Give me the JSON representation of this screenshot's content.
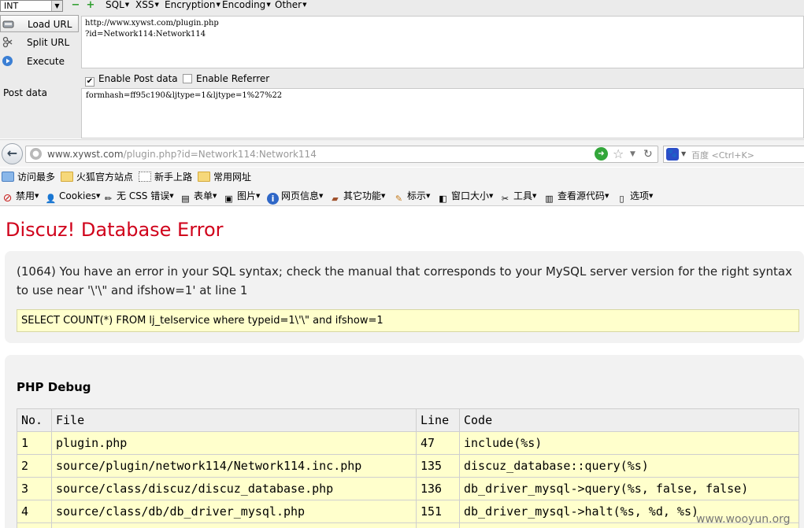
{
  "hackbar": {
    "int_select": "INT",
    "menus": [
      "SQL",
      "XSS",
      "Encryption",
      "Encoding",
      "Other"
    ],
    "actions": {
      "load_url": "Load URL",
      "split_url": "Split URL",
      "execute": "Execute"
    },
    "url_value": "http://www.xywst.com/plugin.php\n?id=Network114:Network114",
    "enable_post_label": "Enable Post data",
    "enable_post_checked": true,
    "enable_referrer_label": "Enable Referrer",
    "enable_referrer_checked": false,
    "post_label": "Post data",
    "post_value": "formhash=ff95c190&ljtype=1&ljtype=1%27%22"
  },
  "navbar": {
    "url_host": "www.xywst.com",
    "url_rest": "/plugin.php?id=Network114:Network114",
    "search_placeholder": "百度 <Ctrl+K>"
  },
  "bookmarks": [
    {
      "label": "访问最多",
      "icon": "most-visited-icon"
    },
    {
      "label": "火狐官方站点",
      "icon": "folder-icon"
    },
    {
      "label": "新手上路",
      "icon": "page-icon"
    },
    {
      "label": "常用网址",
      "icon": "folder-icon"
    }
  ],
  "devbar": [
    "禁用",
    "Cookies",
    "无 CSS 错误",
    "表单",
    "图片",
    "网页信息",
    "其它功能",
    "标示",
    "窗口大小",
    "工具",
    "查看源代码",
    "选项"
  ],
  "page": {
    "error_title": "Discuz! Database Error",
    "error_message": "(1064) You have an error in your SQL syntax; check the manual that corresponds to your MySQL server version for the right syntax to use near '\\'\\\" and ifshow=1' at line 1",
    "error_sql": "SELECT COUNT(*) FROM lj_telservice where typeid=1\\'\\\" and ifshow=1",
    "debug_title": "PHP Debug",
    "debug_headers": [
      "No.",
      "File",
      "Line",
      "Code"
    ],
    "debug_rows": [
      [
        "1",
        "plugin.php",
        "47",
        "include(%s)"
      ],
      [
        "2",
        "source/plugin/network114/Network114.inc.php",
        "135",
        "discuz_database::query(%s)"
      ],
      [
        "3",
        "source/class/discuz/discuz_database.php",
        "136",
        "db_driver_mysql->query(%s, false, false)"
      ],
      [
        "4",
        "source/class/db/db_driver_mysql.php",
        "151",
        "db_driver_mysql->halt(%s, %d, %s)"
      ],
      [
        "",
        "",
        "",
        ""
      ]
    ]
  },
  "watermark": "www.wooyun.org",
  "colors": {
    "error_red": "#d0021b",
    "sql_bg": "#ffffcc",
    "box_bg": "#f2f2f2"
  }
}
